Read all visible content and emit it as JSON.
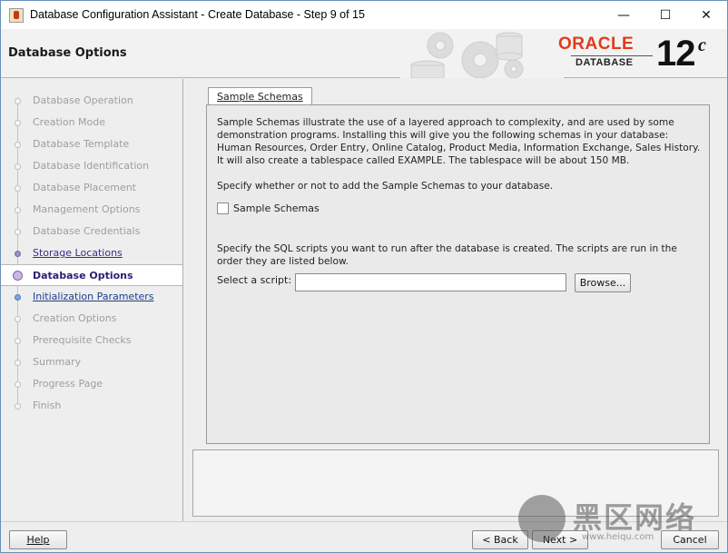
{
  "window": {
    "title": "Database Configuration Assistant - Create Database - Step 9 of 15",
    "controls": {
      "minimize": "—",
      "maximize": "☐",
      "close": "✕"
    }
  },
  "header": {
    "page_title": "Database Options",
    "logo": {
      "brand": "ORACLE",
      "product": "DATABASE",
      "version": "12",
      "version_suffix": "c"
    }
  },
  "sidebar": {
    "steps": [
      {
        "label": "Database Operation",
        "state": "disabled"
      },
      {
        "label": "Creation Mode",
        "state": "disabled"
      },
      {
        "label": "Database Template",
        "state": "disabled"
      },
      {
        "label": "Database Identification",
        "state": "disabled"
      },
      {
        "label": "Database Placement",
        "state": "disabled"
      },
      {
        "label": "Management Options",
        "state": "disabled"
      },
      {
        "label": "Database Credentials",
        "state": "disabled"
      },
      {
        "label": "Storage Locations",
        "state": "done"
      },
      {
        "label": "Database Options",
        "state": "current"
      },
      {
        "label": "Initialization Parameters",
        "state": "next"
      },
      {
        "label": "Creation Options",
        "state": "disabled"
      },
      {
        "label": "Prerequisite Checks",
        "state": "disabled"
      },
      {
        "label": "Summary",
        "state": "disabled"
      },
      {
        "label": "Progress Page",
        "state": "disabled"
      },
      {
        "label": "Finish",
        "state": "disabled"
      }
    ]
  },
  "main": {
    "tab_label": "Sample Schemas",
    "intro_text": "Sample Schemas illustrate the use of a layered approach to complexity, and are used by some demonstration programs. Installing this will give you the following schemas in your database: Human Resources, Order Entry, Online Catalog, Product Media, Information Exchange, Sales History. It will also create a tablespace called EXAMPLE. The tablespace will be about 150 MB.",
    "specify_text": "Specify whether or not to add the Sample Schemas to your database.",
    "checkbox_label": "Sample Schemas",
    "checkbox_checked": false,
    "scripts_text": "Specify the SQL scripts you want to run after the database is created. The scripts are run in the order they are listed below.",
    "script_label": "Select a script:",
    "script_value": "",
    "browse_label": "Browse..."
  },
  "footer": {
    "help_label": "Help",
    "back_label": "< Back",
    "next_label": "Next >",
    "cancel_label": "Cancel"
  },
  "watermark": {
    "text": "黑区网络",
    "url": "www.heiqu.com"
  },
  "colors": {
    "oracle_red": "#e03b1c",
    "done_link": "#3c2a8c",
    "next_link": "#1d3f8a",
    "disabled_text": "#9e9e9e"
  }
}
